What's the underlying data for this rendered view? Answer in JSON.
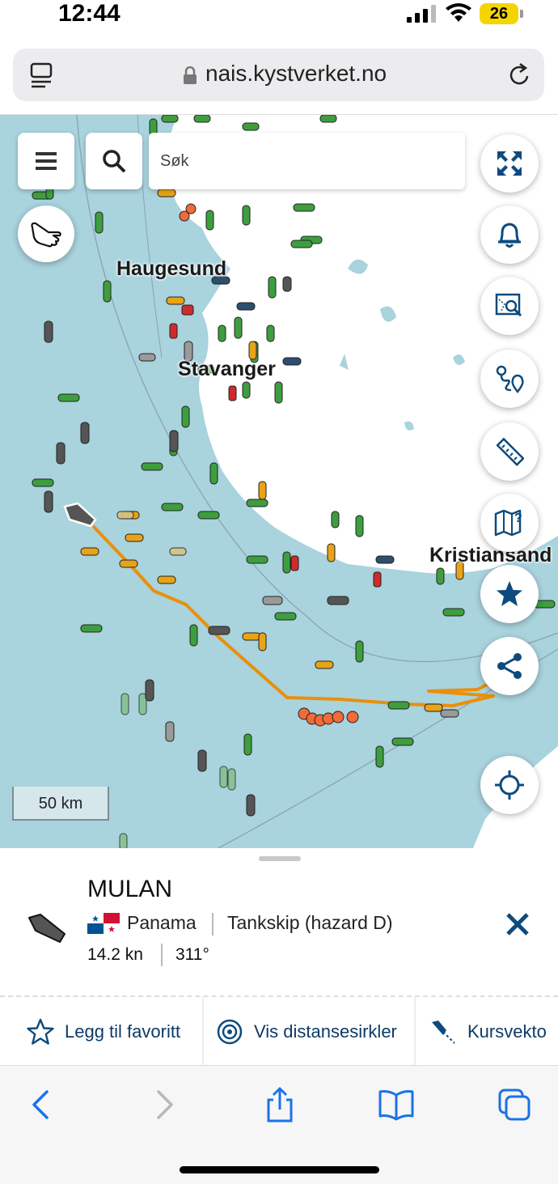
{
  "status_bar": {
    "time": "12:44",
    "battery": "26"
  },
  "browser": {
    "url": "nais.kystverket.no"
  },
  "map": {
    "search_placeholder": "Søk",
    "places": [
      "Haugesund",
      "Stavanger",
      "Kristiansand"
    ],
    "scale_label": "50 km",
    "vessel_colors": {
      "cargo": "#3e9e3e",
      "tanker_hazard": "#e8a317",
      "passenger": "#2d4e6e",
      "other": "#555555",
      "fishing": "#f06a3a",
      "tug": "#d02b2b"
    },
    "track_color": "#e8900b",
    "right_controls": [
      "fullscreen-icon",
      "bell-icon",
      "map-search-icon",
      "route-icon",
      "ruler-icon",
      "map-help-icon",
      "star-icon",
      "share-icon",
      "locate-icon"
    ]
  },
  "vessel": {
    "name": "MULAN",
    "flag_country": "Panama",
    "ship_type": "Tankskip (hazard D)",
    "speed": "14.2 kn",
    "course": "311°"
  },
  "actions": {
    "favorite": "Legg til favoritt",
    "distance_circles": "Vis distansesirkler",
    "course_vector": "Kursvekto"
  }
}
